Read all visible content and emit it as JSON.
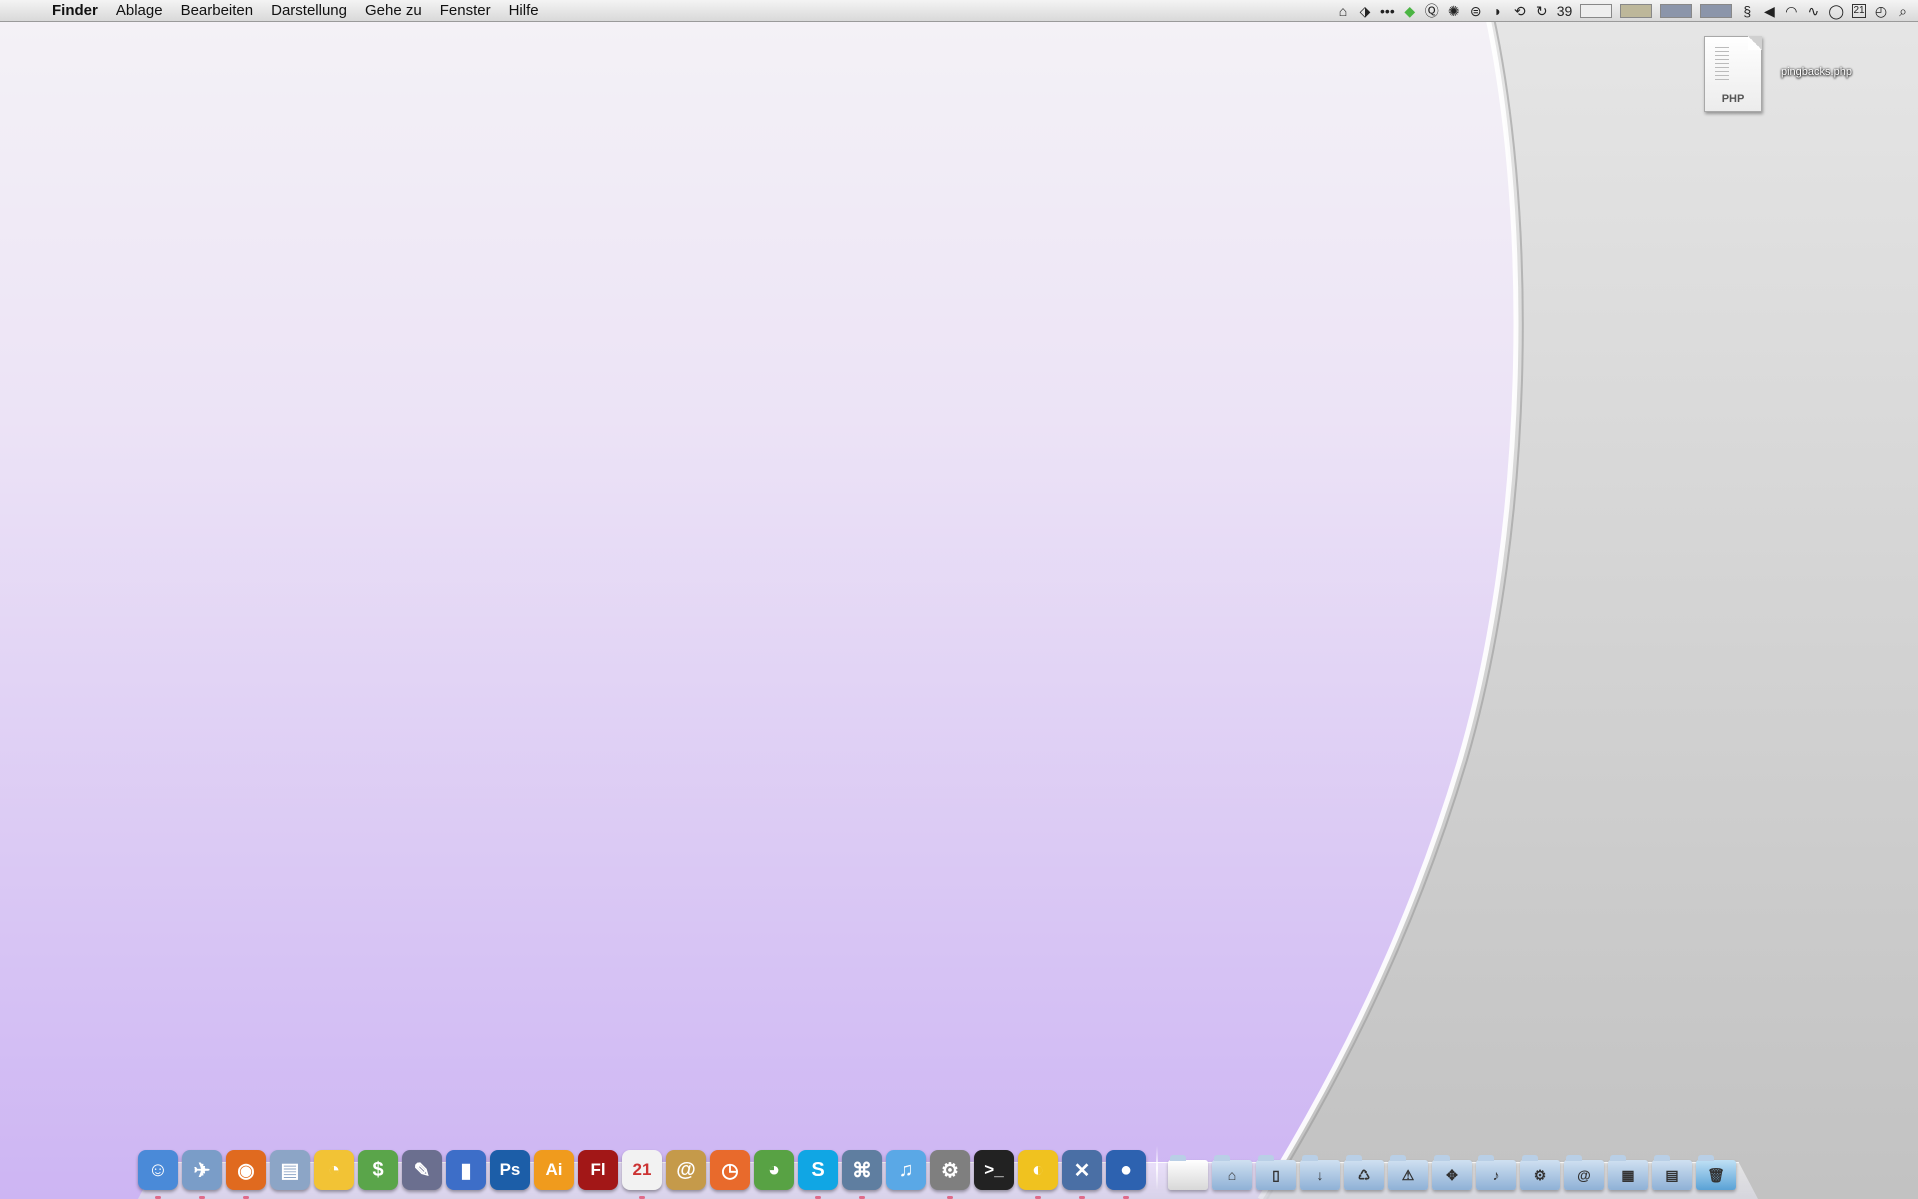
{
  "menubar": {
    "apple_glyph": "",
    "app_name": "Finder",
    "menus": [
      "Ablage",
      "Bearbeiten",
      "Darstellung",
      "Gehe zu",
      "Fenster",
      "Hilfe"
    ],
    "status_number": "39",
    "status_icons": [
      "home-icon",
      "tag-icon",
      "signal-dots-icon",
      "growl-icon",
      "quicksilver-icon",
      "network-icon",
      "sync-icon",
      "airport-sound-icon",
      "time-machine-icon",
      "refresh-icon"
    ],
    "right_icons": [
      "script-icon",
      "volume-icon",
      "wifi-icon",
      "activity-icon",
      "clock-icon",
      "calendar-icon",
      "timer-icon",
      "spotlight-icon"
    ],
    "calendar_day": "21"
  },
  "desktop": {
    "wallpaper_left_top": "#f4f2f6",
    "wallpaper_left_bottom": "#cdb5f3",
    "wallpaper_right": "#cfcfcf",
    "file": {
      "name": "pingbacks.php",
      "type_label": "PHP"
    }
  },
  "dock": {
    "apps": [
      {
        "name": "Finder",
        "glyph": "☺",
        "bg": "#4a8ad8",
        "run": true
      },
      {
        "name": "Preview",
        "glyph": "✈",
        "bg": "#7a9dc8",
        "run": true
      },
      {
        "name": "Firefox",
        "glyph": "◉",
        "bg": "#e06a1f",
        "run": true
      },
      {
        "name": "Preview PDF",
        "glyph": "▤",
        "bg": "#8ca5c6",
        "run": false
      },
      {
        "name": "Cyberduck",
        "glyph": "◔",
        "bg": "#f2c335",
        "run": false
      },
      {
        "name": "Money",
        "glyph": "$",
        "bg": "#5aa54a",
        "run": false
      },
      {
        "name": "Pencil",
        "glyph": "✎",
        "bg": "#6b6f8f",
        "run": false
      },
      {
        "name": "Stats",
        "glyph": "▮",
        "bg": "#3d6ec8",
        "run": false
      },
      {
        "name": "Photoshop",
        "glyph": "Ps",
        "bg": "#1c5ea8",
        "run": false
      },
      {
        "name": "Illustrator",
        "glyph": "Ai",
        "bg": "#f09b1d",
        "run": false
      },
      {
        "name": "Flash",
        "glyph": "Fl",
        "bg": "#a21717",
        "run": false
      },
      {
        "name": "iCal",
        "glyph": "21",
        "bg": "#f2f2f2",
        "run": true
      },
      {
        "name": "Address Book",
        "glyph": "@",
        "bg": "#c59a4a",
        "run": false
      },
      {
        "name": "Timer",
        "glyph": "◷",
        "bg": "#e86a2c",
        "run": false
      },
      {
        "name": "Adium",
        "glyph": "◕",
        "bg": "#58a244",
        "run": false
      },
      {
        "name": "Skype",
        "glyph": "S",
        "bg": "#10a6e4",
        "run": true
      },
      {
        "name": "Network",
        "glyph": "⌘",
        "bg": "#5f7ea0",
        "run": true
      },
      {
        "name": "iTunes",
        "glyph": "♫",
        "bg": "#5aa8e6",
        "run": false
      },
      {
        "name": "System Preferences",
        "glyph": "⚙",
        "bg": "#7f7f7f",
        "run": true
      },
      {
        "name": "Terminal",
        "glyph": ">_",
        "bg": "#222222",
        "run": false
      },
      {
        "name": "Color Picker",
        "glyph": "◐",
        "bg": "#f0c21f",
        "run": true
      },
      {
        "name": "X11",
        "glyph": "✕",
        "bg": "#4a6fa5",
        "run": true
      },
      {
        "name": "Blue Ball",
        "glyph": "●",
        "bg": "#2d62b0",
        "run": true
      }
    ],
    "stacks": [
      {
        "name": "Drive",
        "glyph": ""
      },
      {
        "name": "Home",
        "glyph": "⌂"
      },
      {
        "name": "Documents",
        "glyph": "▯"
      },
      {
        "name": "Downloads",
        "glyph": "↓"
      },
      {
        "name": "Recycle",
        "glyph": "♺"
      },
      {
        "name": "Alerts",
        "glyph": "⚠"
      },
      {
        "name": "Applications",
        "glyph": "✥"
      },
      {
        "name": "Music",
        "glyph": "♪"
      },
      {
        "name": "Settings",
        "glyph": "⚙"
      },
      {
        "name": "Mail",
        "glyph": "@"
      },
      {
        "name": "Archive",
        "glyph": "▦"
      },
      {
        "name": "Web",
        "glyph": "▤"
      },
      {
        "name": "Trash",
        "glyph": "🗑"
      }
    ]
  }
}
